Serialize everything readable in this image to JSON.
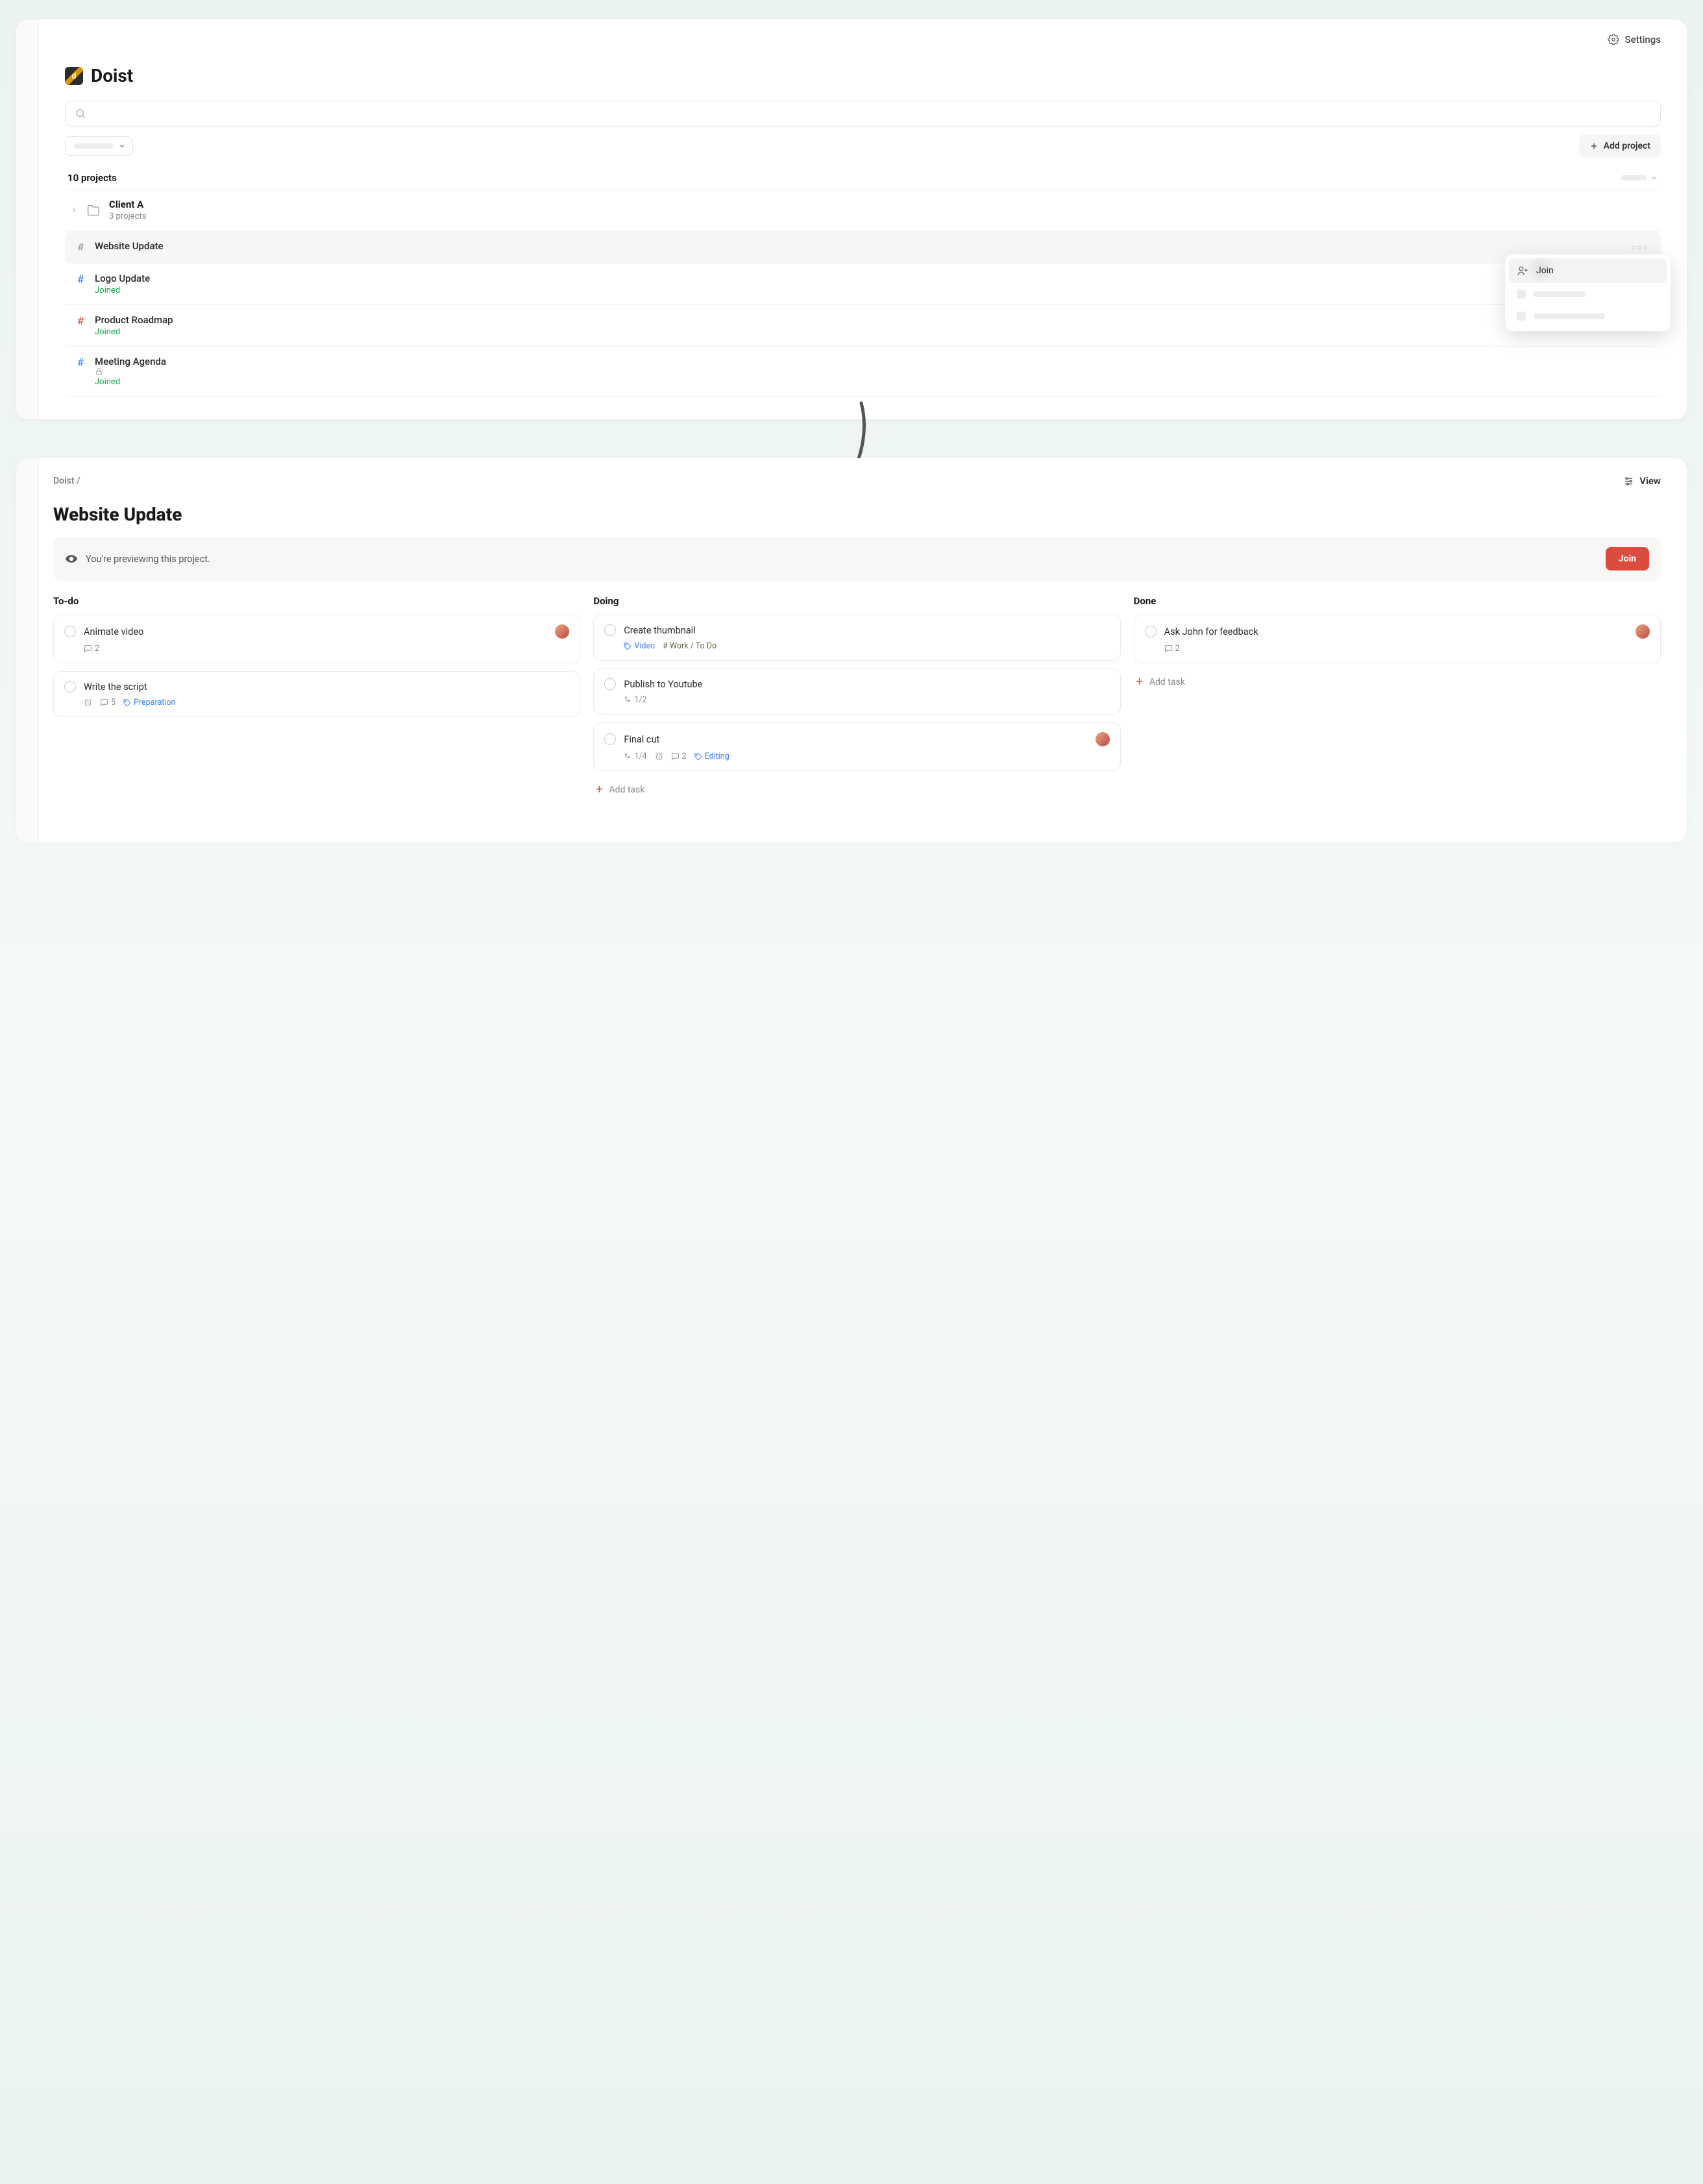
{
  "top": {
    "settings_label": "Settings",
    "workspace_name": "Doist",
    "logo_letter": "d",
    "add_project_label": "Add project",
    "project_count_text": "10 projects",
    "folder": {
      "name": "Client A",
      "subtitle": "3 projects"
    },
    "projects": [
      {
        "name": "Website Update",
        "hash_color": "grey",
        "joined": false,
        "hover": true,
        "locked": false
      },
      {
        "name": "Logo Update",
        "hash_color": "blue",
        "joined": true,
        "hover": false,
        "locked": false
      },
      {
        "name": "Product Roadmap",
        "hash_color": "red",
        "joined": true,
        "hover": false,
        "locked": false
      },
      {
        "name": "Meeting Agenda",
        "hash_color": "blue",
        "joined": true,
        "hover": false,
        "locked": true
      }
    ],
    "joined_label": "Joined",
    "popover_join_label": "Join"
  },
  "bottom": {
    "breadcrumb": "Doist /",
    "view_label": "View",
    "project_title": "Website Update",
    "preview_text": "You're previewing this project.",
    "join_button": "Join",
    "columns": [
      {
        "title": "To-do",
        "cards": [
          {
            "title": "Animate video",
            "avatar": true,
            "comments": "2",
            "alarm": false,
            "sub": null,
            "labels": []
          },
          {
            "title": "Write the script",
            "avatar": false,
            "comments": "5",
            "alarm": true,
            "sub": null,
            "labels": [
              {
                "text": "Preparation",
                "style": "blue",
                "icon": "tag"
              }
            ]
          }
        ],
        "add_task": false
      },
      {
        "title": "Doing",
        "cards": [
          {
            "title": "Create thumbnail",
            "avatar": false,
            "comments": null,
            "alarm": false,
            "sub": null,
            "labels": [
              {
                "text": "Video",
                "style": "blue",
                "icon": "tag"
              },
              {
                "text": "Work / To Do",
                "style": "olive",
                "icon": "hash"
              }
            ]
          },
          {
            "title": "Publish to Youtube",
            "avatar": false,
            "comments": null,
            "alarm": false,
            "sub": "1/2",
            "labels": []
          },
          {
            "title": "Final cut",
            "avatar": true,
            "comments": "2",
            "alarm": true,
            "sub": "1/4",
            "labels": [
              {
                "text": "Editing",
                "style": "blue",
                "icon": "tag"
              }
            ]
          }
        ],
        "add_task": true
      },
      {
        "title": "Done",
        "cards": [
          {
            "title": "Ask John for feedback",
            "avatar": true,
            "comments": "2",
            "alarm": false,
            "sub": null,
            "labels": []
          }
        ],
        "add_task": true
      }
    ],
    "add_task_label": "Add task"
  }
}
